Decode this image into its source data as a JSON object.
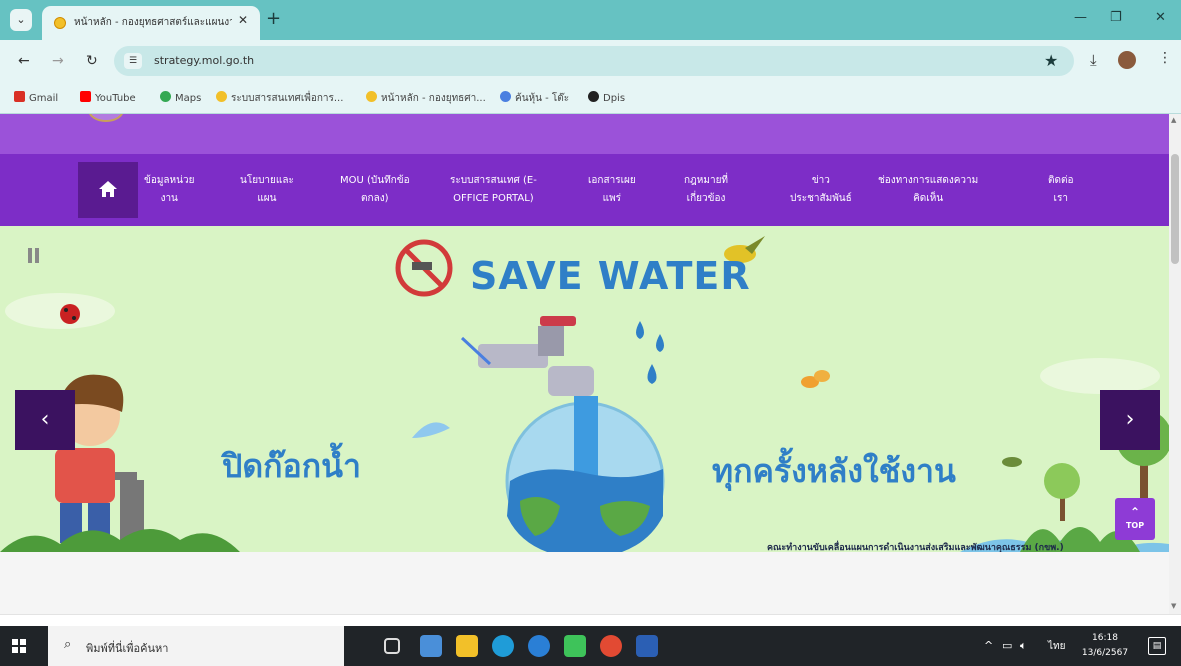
{
  "browser": {
    "tab_title": "หน้าหลัก - กองยุทธศาสตร์และแผนงาน",
    "new_tab": "+",
    "tab_close": "✕",
    "url": "strategy.mol.go.th",
    "bookmarks": [
      {
        "label": "Gmail",
        "color": "#d93025"
      },
      {
        "label": "YouTube",
        "color": "#ff0000"
      },
      {
        "label": "Maps",
        "color": "#34a853"
      },
      {
        "label": "ระบบสารสนเทศเพื่อการ...",
        "color": "#f2c029"
      },
      {
        "label": "หน้าหลัก - กองยุทธศา...",
        "color": "#f2c029"
      },
      {
        "label": "ค้นหุ้น - โต๊ะ",
        "color": "#4a7fe0"
      },
      {
        "label": "Dpis",
        "color": "#222222"
      }
    ]
  },
  "menu": {
    "items": [
      {
        "line1": "ข้อมูลหน่วย",
        "line2": "งาน"
      },
      {
        "line1": "นโยบายและ",
        "line2": "แผน"
      },
      {
        "line1": "MOU (บันทึกข้อ",
        "line2": "ตกลง)"
      },
      {
        "line1": "ระบบสารสนเทศ (E-",
        "line2": "OFFICE PORTAL)"
      },
      {
        "line1": "เอกสารเผย",
        "line2": "แพร่"
      },
      {
        "line1": "กฎหมายที่",
        "line2": "เกี่ยวข้อง"
      },
      {
        "line1": "ข่าว",
        "line2": "ประชาสัมพันธ์"
      },
      {
        "line1": "ช่องทางการแสดงความ",
        "line2": "คิดเห็น"
      },
      {
        "line1": "ติดต่อ",
        "line2": "เรา"
      }
    ]
  },
  "slider": {
    "headline": "SAVE WATER",
    "text_left": "ปิดก๊อกน้ำ",
    "text_right": "ทุกครั้งหลังใช้งาน",
    "credit": "คณะทำงานขับเคลื่อนแผนการดำเนินงานส่งเสริมและพัฒนาคุณธรรม (กขพ.)",
    "prev": "‹",
    "next": "›",
    "top_label": "TOP"
  },
  "taskbar": {
    "search_placeholder": "พิมพ์ที่นี่เพื่อค้นหา",
    "lang": "ไทย",
    "time": "16:18",
    "date": "13/6/2567"
  },
  "colors": {
    "menu_bg": "#7d2dc7",
    "band_bg": "#9b52d9",
    "headline": "#2f7fc7",
    "chrome": "#66c2c2"
  }
}
